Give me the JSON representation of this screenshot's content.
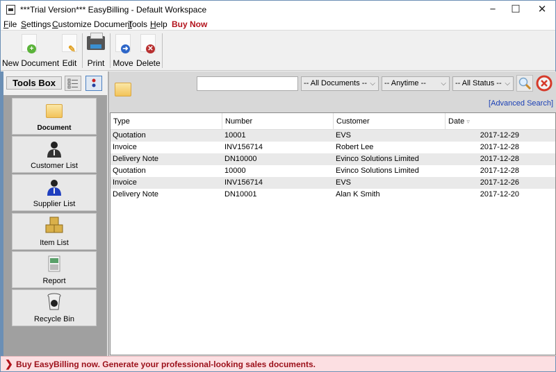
{
  "window": {
    "title": "***Trial Version*** EasyBilling - Default Workspace",
    "minimize": "−",
    "maximize": "☐",
    "close": "✕"
  },
  "menu": [
    {
      "u": "F",
      "rest": "ile"
    },
    {
      "u": "S",
      "rest": "ettings"
    },
    {
      "u": "C",
      "rest": "ustomize Document"
    },
    {
      "u": "T",
      "rest": "ools"
    },
    {
      "u": "H",
      "rest": "elp"
    }
  ],
  "menu_buy_now": "Buy Now",
  "toolbar": {
    "new_document": "New Document",
    "edit": "Edit",
    "print": "Print",
    "move": "Move",
    "delete": "Delete"
  },
  "sidebar": {
    "tools_box": "Tools Box",
    "items": [
      {
        "label": "Document",
        "icon": "folder-icon",
        "glyph": "📂"
      },
      {
        "label": "Customer List",
        "icon": "customer-icon",
        "glyph": "👤"
      },
      {
        "label": "Supplier List",
        "icon": "supplier-icon",
        "glyph": "👤"
      },
      {
        "label": "Item List",
        "icon": "boxes-icon",
        "glyph": "📦"
      },
      {
        "label": "Report",
        "icon": "report-icon",
        "glyph": "📊"
      },
      {
        "label": "Recycle Bin",
        "icon": "recycle-bin-icon",
        "glyph": "♻"
      }
    ]
  },
  "filters": {
    "search_value": "",
    "doc_type": "-- All Documents --",
    "time": "-- Anytime --",
    "status": "-- All Status --",
    "advanced_search": "[Advanced Search]"
  },
  "table": {
    "headers": [
      "Type",
      "Number",
      "Customer",
      "Date"
    ],
    "sort_indicator": "▿",
    "rows": [
      [
        "Quotation",
        "10001",
        "EVS",
        "2017-12-29"
      ],
      [
        "Invoice",
        "INV156714",
        "Robert Lee",
        "2017-12-28"
      ],
      [
        "Delivery Note",
        "DN10000",
        "Evinco Solutions Limited",
        "2017-12-28"
      ],
      [
        "Quotation",
        "10000",
        "Evinco Solutions Limited",
        "2017-12-28"
      ],
      [
        "Invoice",
        "INV156714",
        "EVS",
        "2017-12-26"
      ],
      [
        "Delivery Note",
        "DN10001",
        "Alan K Smith",
        "2017-12-20"
      ]
    ]
  },
  "banner": {
    "arrow": "❯",
    "text": "Buy EasyBilling now. Generate your professional-looking sales documents."
  },
  "colors": {
    "accent_red": "#b3131c",
    "link_blue": "#1a3fb5",
    "banner_bg": "#fcdfe2"
  }
}
